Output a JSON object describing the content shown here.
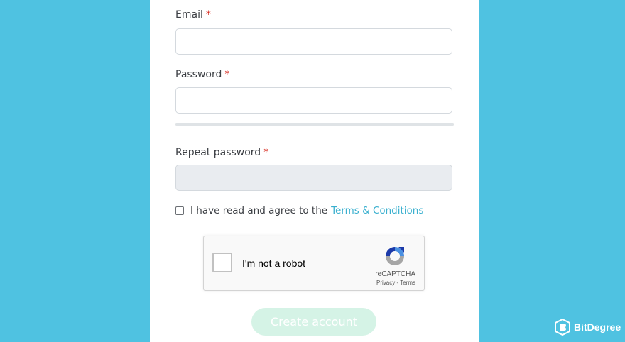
{
  "form": {
    "email_label": "Email",
    "password_label": "Password",
    "repeat_label": "Repeat password",
    "required_mark": "*",
    "email_value": "",
    "password_value": "",
    "repeat_value": ""
  },
  "terms": {
    "text": "I have read and agree to the",
    "link": "Terms & Conditions",
    "checked": false
  },
  "recaptcha": {
    "label": "I'm not a robot",
    "brand": "reCAPTCHA",
    "links": "Privacy - Terms"
  },
  "submit": {
    "label": "Create account"
  },
  "watermark": {
    "text": "BitDegree"
  },
  "colors": {
    "background": "#4fc2e1",
    "link": "#3bb0cf",
    "button_disabled": "#d5f3e6",
    "required": "#d93025"
  }
}
